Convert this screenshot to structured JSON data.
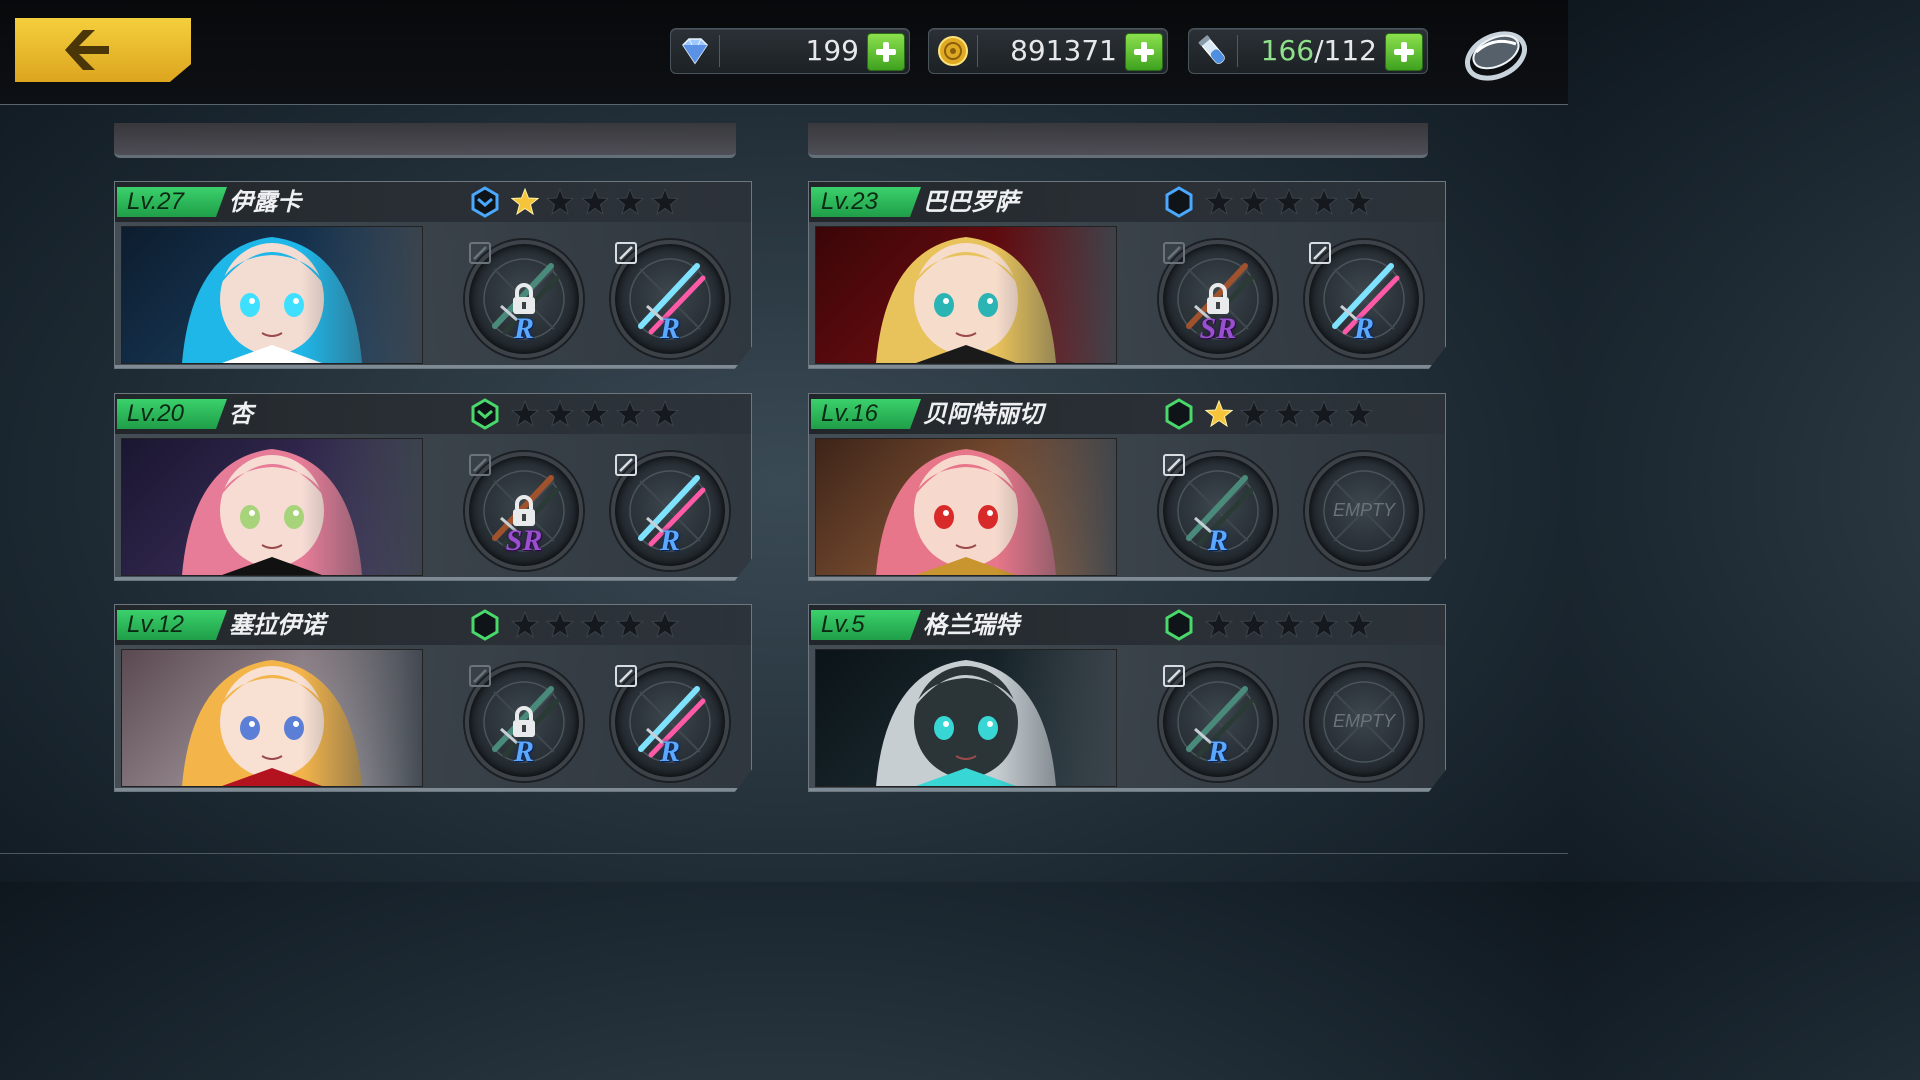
{
  "header": {
    "back_button": "back-arrow-icon",
    "resources": [
      {
        "name": "gems",
        "icon": "gem-icon",
        "value": "199"
      },
      {
        "name": "gold",
        "icon": "coin-icon",
        "value": "891371"
      },
      {
        "name": "stamina",
        "icon": "potion-icon",
        "current": "166",
        "max": "/112"
      }
    ],
    "menu_icon": "ring-icon"
  },
  "characters": [
    {
      "level": "Lv.27",
      "name": "伊露卡",
      "rank_color": "#4aa8ff",
      "stars_filled": 1,
      "slots": [
        {
          "locked": true,
          "rarity": "R"
        },
        {
          "locked": false,
          "rarity": "R"
        }
      ]
    },
    {
      "level": "Lv.23",
      "name": "巴巴罗萨",
      "rank_color": "#4aa8ff",
      "stars_filled": 0,
      "slots": [
        {
          "locked": true,
          "rarity": "SR"
        },
        {
          "locked": false,
          "rarity": "R"
        }
      ]
    },
    {
      "level": "Lv.20",
      "name": "杏",
      "rank_color": "#49d96b",
      "stars_filled": 0,
      "slots": [
        {
          "locked": true,
          "rarity": "SR"
        },
        {
          "locked": false,
          "rarity": "R"
        }
      ]
    },
    {
      "level": "Lv.16",
      "name": "贝阿特丽切",
      "rank_color": "#49d96b",
      "stars_filled": 1,
      "slots": [
        {
          "locked": false,
          "rarity": "R"
        },
        {
          "empty": true,
          "label": "EMPTY"
        }
      ]
    },
    {
      "level": "Lv.12",
      "name": "塞拉伊诺",
      "rank_color": "#49d96b",
      "stars_filled": 0,
      "slots": [
        {
          "locked": true,
          "rarity": "R"
        },
        {
          "locked": false,
          "rarity": "R"
        }
      ]
    },
    {
      "level": "Lv.5",
      "name": "格兰瑞特",
      "rank_color": "#49d96b",
      "stars_filled": 0,
      "slots": [
        {
          "locked": false,
          "rarity": "R"
        },
        {
          "empty": true,
          "label": "EMPTY"
        }
      ]
    }
  ],
  "colors": {
    "accent": "#f2c531",
    "level_green": "#35c763",
    "star_gold": "#f5c43a",
    "star_empty": "#15191d"
  }
}
